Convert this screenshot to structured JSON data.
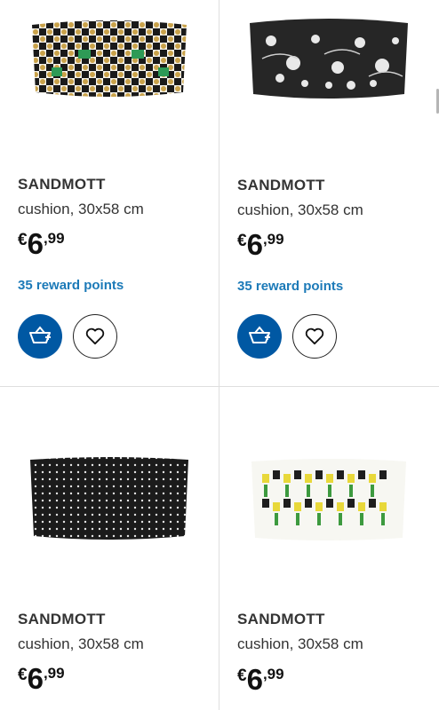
{
  "products": [
    {
      "name": "SANDMOTT",
      "description": "cushion, 30x58 cm",
      "currency": "€",
      "price_int": "6",
      "price_dec": ",99",
      "reward": "35 reward points",
      "image": "cushion-geometric-green-yellow"
    },
    {
      "name": "SANDMOTT",
      "description": "cushion, 30x58 cm",
      "currency": "€",
      "price_int": "6",
      "price_dec": ",99",
      "reward": "35 reward points",
      "image": "cushion-floral-black-white"
    },
    {
      "name": "SANDMOTT",
      "description": "cushion, 30x58 cm",
      "currency": "€",
      "price_int": "6",
      "price_dec": ",99",
      "image": "cushion-black-dots"
    },
    {
      "name": "SANDMOTT",
      "description": "cushion, 30x58 cm",
      "currency": "€",
      "price_int": "6",
      "price_dec": ",99",
      "image": "cushion-tulips"
    }
  ],
  "icons": {
    "cart": "add-to-cart-icon",
    "favourite": "heart-icon"
  },
  "colors": {
    "cart_button": "#0058a3",
    "reward_text": "#1c7ab8",
    "divider": "#dfdfdf"
  }
}
